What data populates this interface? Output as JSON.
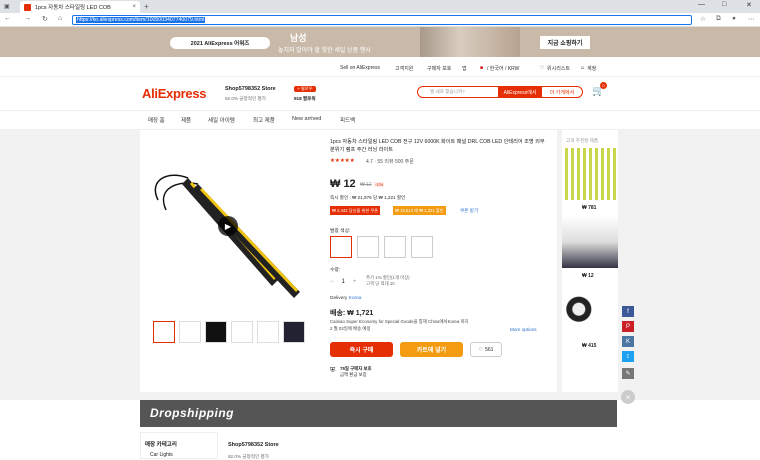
{
  "browser": {
    "tab_title": "1pcs 자동차 스타일링 LED COB",
    "url": "https://ko.aliexpress.com/item/1005003407740079.html"
  },
  "banner": {
    "badge": "2021 AliExpress 어워즈",
    "headline": "남성",
    "subline": "놓치지 말아야 할 핫한 세일 상품 행사",
    "cta": "지금 쇼핑하기"
  },
  "topbar": {
    "sell": "Sell on AliExpress",
    "help": "고객지원",
    "buyer": "구매자 보호",
    "app": "앱",
    "locale": "/ 한국어 / KRW",
    "wishlist": "위시리스트",
    "account": "계정"
  },
  "header": {
    "logo": "AliExpress",
    "store_name": "Shop5798352 Store",
    "store_rating": "92.0% 긍정적인 평가",
    "follow": "+ 팔로우",
    "followers": "918 팔로워",
    "search_placeholder": "뭘 새로 찾습니까?",
    "search_ali": "AliExpress에서",
    "search_store": "이 가게에서",
    "cart_count": "0"
  },
  "storenav": {
    "items": [
      "매장 홈",
      "제품",
      "세일 아이템",
      "최고 제품",
      "New arrived",
      "피드백"
    ]
  },
  "product": {
    "title": "1pcs 자동차 스타일링 LED COB 전구 12V 6000K 화이트 패널 DRL COB LED 인테리어 조명 외부 분위기 램프 주간 러닝 라이트",
    "stars": "★★★★★",
    "rating": "4.7",
    "reviews": "55 리뷰",
    "orders": "500 주문",
    "price": "₩ 12",
    "old_price": "₩ 12",
    "discount": "-1%",
    "promo": "즉시 할인 : ₩ 21,976 당 ₩ 1,221 할인",
    "coupon1": "₩ 2,442 당신을 위한 쿠폰",
    "coupon2": "₩ 15,513 에 ₩ 1,221 할인",
    "coupon_more": "쿠폰 받기",
    "color_label": "발광 색상:",
    "qty_label": "수량:",
    "qty_value": "1",
    "qty_note1": "추가 1% 할인(1개 이상)",
    "qty_note2": "고객 당 최대 10",
    "delivery_label": "Delivery",
    "delivery_to": "Korea",
    "shipping_price": "배송: ₩ 1,721",
    "shipping_desc": "Cainiao Super Economy for Special Goods을 통해 China에서Korea 까지",
    "shipping_eta": "2 월 02일에 배송 예정",
    "more_options": "More options",
    "buy_now": "즉시 구매",
    "add_cart": "카트에 넣기",
    "wish_count": "561",
    "guarantee1": "75일 구매자 보호",
    "guarantee2": "금액 환급 보증"
  },
  "recommend": {
    "title": "고객 추천할 제품",
    "prices": [
      "₩ 781",
      "₩ 12",
      "₩ 415"
    ]
  },
  "bottom": {
    "dropshipping": "Dropshipping",
    "category_title": "매장 카테고리",
    "category_item": "Car Lights",
    "store_name": "Shop5798352 Store",
    "store_rating": "92.0% 긍정적인 평가"
  },
  "colors": {
    "accent": "#e62e04",
    "orange": "#f39c12"
  }
}
